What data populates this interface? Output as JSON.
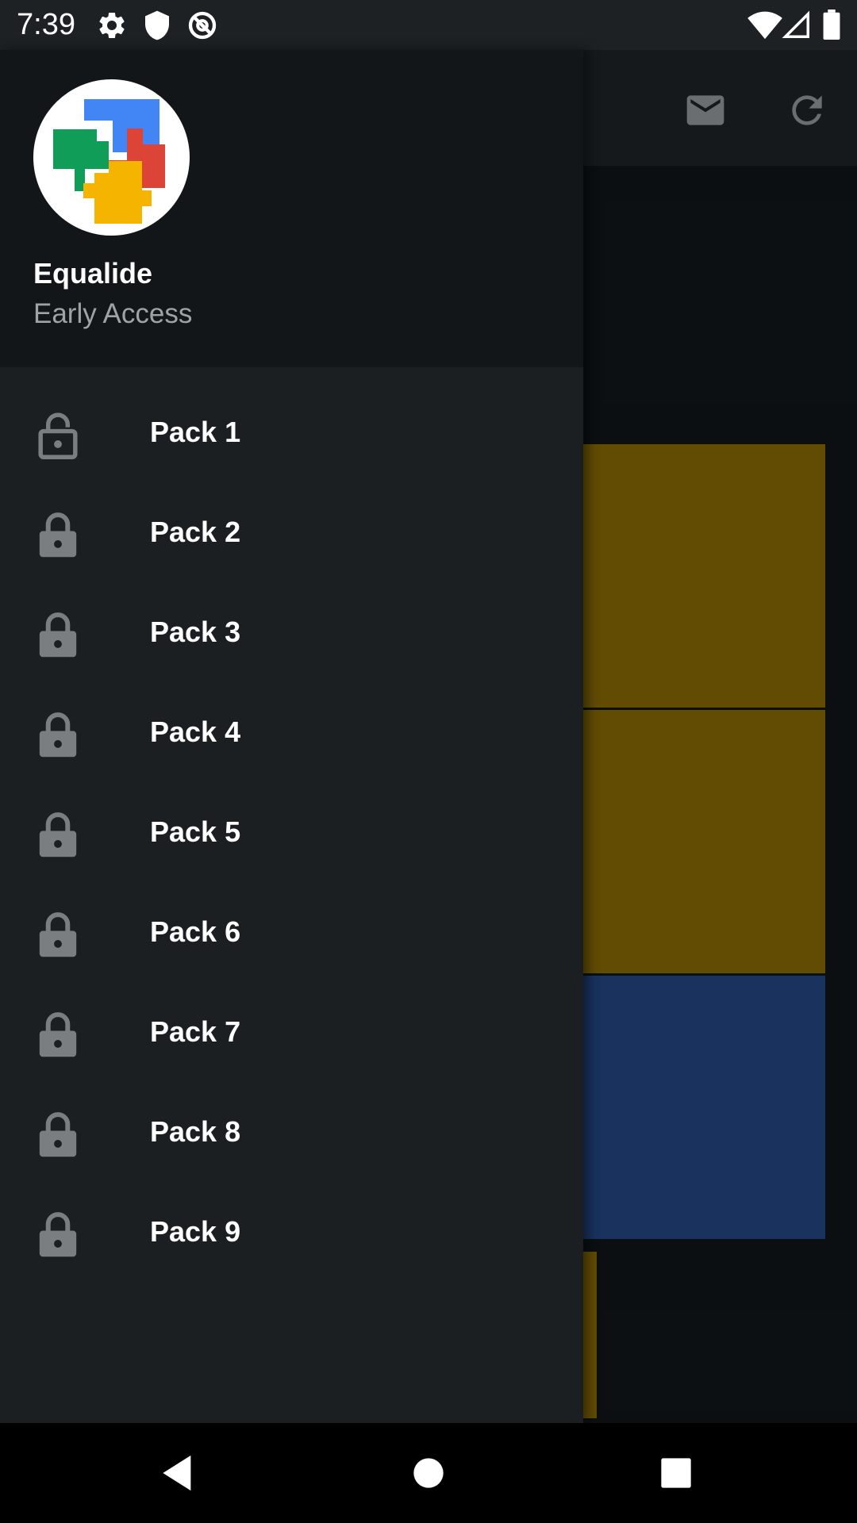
{
  "status_bar": {
    "time": "7:39",
    "icons": [
      "gear-icon",
      "shield-icon",
      "dnd-icon",
      "wifi-icon",
      "signal-icon",
      "battery-icon"
    ]
  },
  "toolbar": {
    "icons": [
      "mail-icon",
      "refresh-icon"
    ]
  },
  "drawer": {
    "app_name": "Equalide",
    "app_subtitle": "Early Access",
    "items": [
      {
        "label": "Pack 1",
        "icon": "lock-open-icon",
        "locked": false
      },
      {
        "label": "Pack 2",
        "icon": "lock-icon",
        "locked": true
      },
      {
        "label": "Pack 3",
        "icon": "lock-icon",
        "locked": true
      },
      {
        "label": "Pack 4",
        "icon": "lock-icon",
        "locked": true
      },
      {
        "label": "Pack 5",
        "icon": "lock-icon",
        "locked": true
      },
      {
        "label": "Pack 6",
        "icon": "lock-icon",
        "locked": true
      },
      {
        "label": "Pack 7",
        "icon": "lock-icon",
        "locked": true
      },
      {
        "label": "Pack 8",
        "icon": "lock-icon",
        "locked": true
      },
      {
        "label": "Pack 9",
        "icon": "lock-icon",
        "locked": true
      }
    ]
  },
  "colors": {
    "drawer_bg": "#1b1f22",
    "header_bg": "#121618",
    "tile_gold": "#644e05",
    "tile_blue": "#1a3360",
    "logo_blue": "#4285f4",
    "logo_red": "#db4437",
    "logo_green": "#0f9d58",
    "logo_yellow": "#f4b400",
    "icon_gray": "#7a7e80"
  },
  "nav_bar": {
    "buttons": [
      "back-icon",
      "home-icon",
      "recents-icon"
    ]
  }
}
